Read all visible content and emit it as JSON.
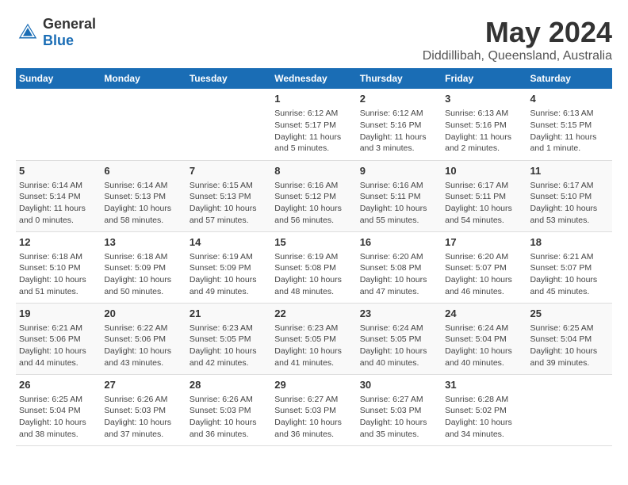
{
  "header": {
    "logo_general": "General",
    "logo_blue": "Blue",
    "title": "May 2024",
    "subtitle": "Diddillibah, Queensland, Australia"
  },
  "weekdays": [
    "Sunday",
    "Monday",
    "Tuesday",
    "Wednesday",
    "Thursday",
    "Friday",
    "Saturday"
  ],
  "weeks": [
    [
      {
        "day": "",
        "info": ""
      },
      {
        "day": "",
        "info": ""
      },
      {
        "day": "",
        "info": ""
      },
      {
        "day": "1",
        "info": "Sunrise: 6:12 AM\nSunset: 5:17 PM\nDaylight: 11 hours\nand 5 minutes."
      },
      {
        "day": "2",
        "info": "Sunrise: 6:12 AM\nSunset: 5:16 PM\nDaylight: 11 hours\nand 3 minutes."
      },
      {
        "day": "3",
        "info": "Sunrise: 6:13 AM\nSunset: 5:16 PM\nDaylight: 11 hours\nand 2 minutes."
      },
      {
        "day": "4",
        "info": "Sunrise: 6:13 AM\nSunset: 5:15 PM\nDaylight: 11 hours\nand 1 minute."
      }
    ],
    [
      {
        "day": "5",
        "info": "Sunrise: 6:14 AM\nSunset: 5:14 PM\nDaylight: 11 hours\nand 0 minutes."
      },
      {
        "day": "6",
        "info": "Sunrise: 6:14 AM\nSunset: 5:13 PM\nDaylight: 10 hours\nand 58 minutes."
      },
      {
        "day": "7",
        "info": "Sunrise: 6:15 AM\nSunset: 5:13 PM\nDaylight: 10 hours\nand 57 minutes."
      },
      {
        "day": "8",
        "info": "Sunrise: 6:16 AM\nSunset: 5:12 PM\nDaylight: 10 hours\nand 56 minutes."
      },
      {
        "day": "9",
        "info": "Sunrise: 6:16 AM\nSunset: 5:11 PM\nDaylight: 10 hours\nand 55 minutes."
      },
      {
        "day": "10",
        "info": "Sunrise: 6:17 AM\nSunset: 5:11 PM\nDaylight: 10 hours\nand 54 minutes."
      },
      {
        "day": "11",
        "info": "Sunrise: 6:17 AM\nSunset: 5:10 PM\nDaylight: 10 hours\nand 53 minutes."
      }
    ],
    [
      {
        "day": "12",
        "info": "Sunrise: 6:18 AM\nSunset: 5:10 PM\nDaylight: 10 hours\nand 51 minutes."
      },
      {
        "day": "13",
        "info": "Sunrise: 6:18 AM\nSunset: 5:09 PM\nDaylight: 10 hours\nand 50 minutes."
      },
      {
        "day": "14",
        "info": "Sunrise: 6:19 AM\nSunset: 5:09 PM\nDaylight: 10 hours\nand 49 minutes."
      },
      {
        "day": "15",
        "info": "Sunrise: 6:19 AM\nSunset: 5:08 PM\nDaylight: 10 hours\nand 48 minutes."
      },
      {
        "day": "16",
        "info": "Sunrise: 6:20 AM\nSunset: 5:08 PM\nDaylight: 10 hours\nand 47 minutes."
      },
      {
        "day": "17",
        "info": "Sunrise: 6:20 AM\nSunset: 5:07 PM\nDaylight: 10 hours\nand 46 minutes."
      },
      {
        "day": "18",
        "info": "Sunrise: 6:21 AM\nSunset: 5:07 PM\nDaylight: 10 hours\nand 45 minutes."
      }
    ],
    [
      {
        "day": "19",
        "info": "Sunrise: 6:21 AM\nSunset: 5:06 PM\nDaylight: 10 hours\nand 44 minutes."
      },
      {
        "day": "20",
        "info": "Sunrise: 6:22 AM\nSunset: 5:06 PM\nDaylight: 10 hours\nand 43 minutes."
      },
      {
        "day": "21",
        "info": "Sunrise: 6:23 AM\nSunset: 5:05 PM\nDaylight: 10 hours\nand 42 minutes."
      },
      {
        "day": "22",
        "info": "Sunrise: 6:23 AM\nSunset: 5:05 PM\nDaylight: 10 hours\nand 41 minutes."
      },
      {
        "day": "23",
        "info": "Sunrise: 6:24 AM\nSunset: 5:05 PM\nDaylight: 10 hours\nand 40 minutes."
      },
      {
        "day": "24",
        "info": "Sunrise: 6:24 AM\nSunset: 5:04 PM\nDaylight: 10 hours\nand 40 minutes."
      },
      {
        "day": "25",
        "info": "Sunrise: 6:25 AM\nSunset: 5:04 PM\nDaylight: 10 hours\nand 39 minutes."
      }
    ],
    [
      {
        "day": "26",
        "info": "Sunrise: 6:25 AM\nSunset: 5:04 PM\nDaylight: 10 hours\nand 38 minutes."
      },
      {
        "day": "27",
        "info": "Sunrise: 6:26 AM\nSunset: 5:03 PM\nDaylight: 10 hours\nand 37 minutes."
      },
      {
        "day": "28",
        "info": "Sunrise: 6:26 AM\nSunset: 5:03 PM\nDaylight: 10 hours\nand 36 minutes."
      },
      {
        "day": "29",
        "info": "Sunrise: 6:27 AM\nSunset: 5:03 PM\nDaylight: 10 hours\nand 36 minutes."
      },
      {
        "day": "30",
        "info": "Sunrise: 6:27 AM\nSunset: 5:03 PM\nDaylight: 10 hours\nand 35 minutes."
      },
      {
        "day": "31",
        "info": "Sunrise: 6:28 AM\nSunset: 5:02 PM\nDaylight: 10 hours\nand 34 minutes."
      },
      {
        "day": "",
        "info": ""
      }
    ]
  ]
}
